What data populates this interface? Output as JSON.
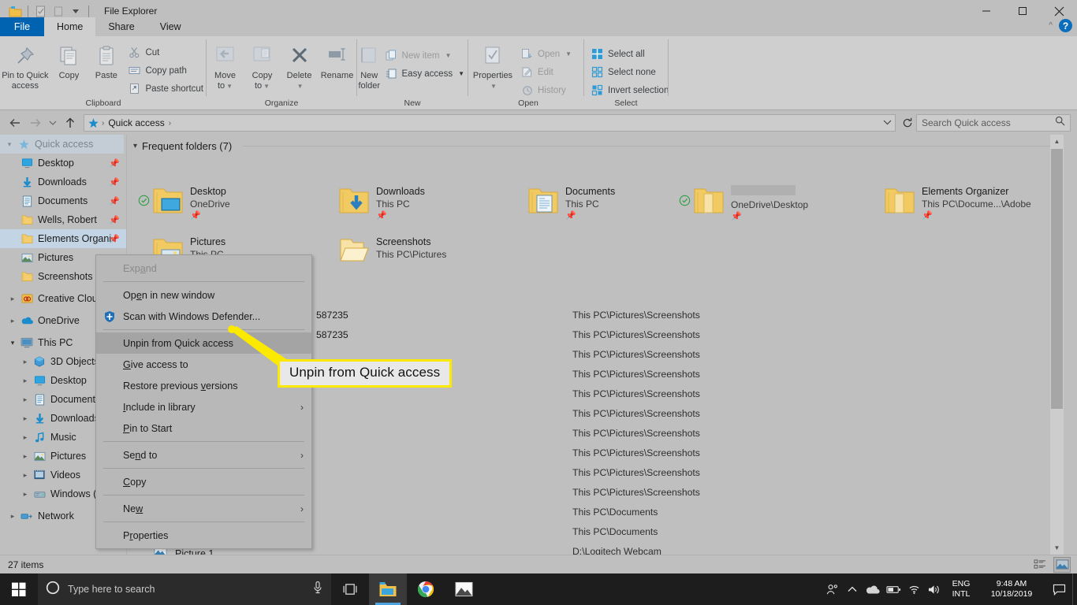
{
  "window": {
    "title": "File Explorer",
    "quick_access_toolbar": [
      "explorer-icon",
      "properties-icon",
      "new-folder-icon",
      "customize-dropdown"
    ],
    "controls": {
      "minimize": "minimize-icon",
      "maximize": "maximize-icon",
      "close": "close-icon"
    }
  },
  "ribbon": {
    "tabs": [
      {
        "label": "File",
        "active": false,
        "file": true
      },
      {
        "label": "Home",
        "active": true
      },
      {
        "label": "Share",
        "active": false
      },
      {
        "label": "View",
        "active": false
      }
    ],
    "help_label": "?",
    "groups": [
      {
        "title": "Clipboard",
        "big_buttons": [
          {
            "label": "Pin to Quick\naccess",
            "line1": "Pin to Quick",
            "line2": "access",
            "icon": "pin-icon"
          },
          {
            "label": "Copy",
            "line1": "Copy",
            "line2": "",
            "icon": "copy-icon"
          },
          {
            "label": "Paste",
            "line1": "Paste",
            "line2": "",
            "icon": "paste-icon"
          }
        ],
        "small_buttons": [
          {
            "label": "Cut",
            "icon": "scissors-icon"
          },
          {
            "label": "Copy path",
            "icon": "copy-path-icon"
          },
          {
            "label": "Paste shortcut",
            "icon": "paste-shortcut-icon"
          }
        ]
      },
      {
        "title": "Organize",
        "big_buttons": [
          {
            "line1": "Move",
            "line2": "to",
            "icon": "move-to-icon",
            "dropdown": true,
            "disabled": true
          },
          {
            "line1": "Copy",
            "line2": "to",
            "icon": "copy-to-icon",
            "dropdown": true,
            "disabled": true
          },
          {
            "line1": "Delete",
            "line2": "",
            "icon": "delete-icon",
            "dropdown": true
          },
          {
            "line1": "Rename",
            "line2": "",
            "icon": "rename-icon"
          }
        ]
      },
      {
        "title": "New",
        "big_buttons": [
          {
            "line1": "New",
            "line2": "folder",
            "icon": "new-folder-icon"
          }
        ],
        "small_buttons": [
          {
            "label": "New item",
            "icon": "new-item-icon",
            "dropdown": true
          },
          {
            "label": "Easy access",
            "icon": "easy-access-icon",
            "dropdown": true
          }
        ]
      },
      {
        "title": "Open",
        "big_buttons": [
          {
            "line1": "Properties",
            "line2": "",
            "icon": "properties-icon",
            "dropdown": true
          }
        ],
        "small_buttons": [
          {
            "label": "Open",
            "icon": "open-icon",
            "dropdown": true
          },
          {
            "label": "Edit",
            "icon": "edit-icon"
          },
          {
            "label": "History",
            "icon": "history-icon"
          }
        ]
      },
      {
        "title": "Select",
        "small_buttons": [
          {
            "label": "Select all",
            "icon": "select-all-icon"
          },
          {
            "label": "Select none",
            "icon": "select-none-icon"
          },
          {
            "label": "Invert selection",
            "icon": "invert-selection-icon"
          }
        ]
      }
    ]
  },
  "addressbar": {
    "back": "back-arrow-icon",
    "forward": "forward-arrow-icon",
    "recent": "recent-locations-icon",
    "up": "up-arrow-icon",
    "crumb_icon": "quick-access-star-icon",
    "crumbs": [
      "Quick access"
    ],
    "refresh": "refresh-icon",
    "dropdown": "chevron-down-icon"
  },
  "search": {
    "placeholder": "Search Quick access",
    "icon": "search-icon"
  },
  "navpane": {
    "items": [
      {
        "label": "Quick access",
        "icon": "star-icon",
        "indent": 0,
        "chevron": "open",
        "selected": false
      },
      {
        "label": "Desktop",
        "icon": "desktop-icon",
        "indent": 1,
        "chevron": "none",
        "pinned": true
      },
      {
        "label": "Downloads",
        "icon": "downloads-icon",
        "indent": 1,
        "chevron": "none",
        "pinned": true
      },
      {
        "label": "Documents",
        "icon": "documents-icon",
        "indent": 1,
        "chevron": "none",
        "pinned": true
      },
      {
        "label": "Wells, Robert",
        "icon": "folder-icon",
        "indent": 1,
        "chevron": "none",
        "pinned": true
      },
      {
        "label": "Elements Organi",
        "icon": "folder-icon",
        "indent": 1,
        "chevron": "none",
        "pinned": true,
        "selected": true
      },
      {
        "label": "Pictures",
        "icon": "pictures-icon",
        "indent": 1,
        "chevron": "none",
        "pinned": false
      },
      {
        "label": "Screenshots",
        "icon": "folder-icon",
        "indent": 1,
        "chevron": "none",
        "pinned": false
      },
      {
        "label": "Creative Cloud",
        "icon": "creative-cloud-icon",
        "indent": 0,
        "chevron": "closed"
      },
      {
        "label": "OneDrive",
        "icon": "onedrive-icon",
        "indent": 0,
        "chevron": "closed"
      },
      {
        "label": "This PC",
        "icon": "this-pc-icon",
        "indent": 0,
        "chevron": "open"
      },
      {
        "label": "3D Objects",
        "icon": "3d-objects-icon",
        "indent": 1,
        "chevron": "closed"
      },
      {
        "label": "Desktop",
        "icon": "desktop-icon",
        "indent": 1,
        "chevron": "closed"
      },
      {
        "label": "Documents",
        "icon": "documents-icon",
        "indent": 1,
        "chevron": "closed"
      },
      {
        "label": "Downloads",
        "icon": "downloads-icon",
        "indent": 1,
        "chevron": "closed"
      },
      {
        "label": "Music",
        "icon": "music-icon",
        "indent": 1,
        "chevron": "closed"
      },
      {
        "label": "Pictures",
        "icon": "pictures-icon",
        "indent": 1,
        "chevron": "closed"
      },
      {
        "label": "Videos",
        "icon": "videos-icon",
        "indent": 1,
        "chevron": "closed"
      },
      {
        "label": "Windows (C:)",
        "icon": "drive-icon",
        "indent": 1,
        "chevron": "closed"
      },
      {
        "label": "Network",
        "icon": "network-icon",
        "indent": 0,
        "chevron": "closed"
      }
    ]
  },
  "main": {
    "section_header": "Frequent folders (7)",
    "frequent_folders": [
      {
        "name": "Desktop",
        "path": "OneDrive",
        "icon": "folder-desktop-icon",
        "pinned": true,
        "sync": true,
        "redacted": false
      },
      {
        "name": "Downloads",
        "path": "This PC",
        "icon": "folder-downloads-icon",
        "pinned": true,
        "sync": false,
        "redacted": false
      },
      {
        "name": "Documents",
        "path": "This PC",
        "icon": "folder-documents-icon",
        "pinned": true,
        "sync": false,
        "redacted": false
      },
      {
        "name": "",
        "path": "OneDrive\\Desktop",
        "icon": "folder-icon",
        "pinned": true,
        "sync": true,
        "redacted": true
      },
      {
        "name": "Elements Organizer",
        "path": "This PC\\Docume...\\Adobe",
        "icon": "folder-icon",
        "pinned": true,
        "sync": false,
        "redacted": false
      },
      {
        "name": "Pictures",
        "path": "This PC",
        "icon": "folder-pictures-icon",
        "pinned": true,
        "sync": false,
        "redacted": false
      },
      {
        "name": "Screenshots",
        "path": "This PC\\Pictures",
        "icon": "folder-open-icon",
        "pinned": false,
        "sync": false,
        "redacted": false
      }
    ],
    "detail_rows": [
      {
        "name": "587235",
        "path": "This PC\\Pictures\\Screenshots"
      },
      {
        "name": "587235",
        "path": "This PC\\Pictures\\Screenshots"
      },
      {
        "name": "",
        "path": "This PC\\Pictures\\Screenshots"
      },
      {
        "name": "",
        "path": "This PC\\Pictures\\Screenshots"
      },
      {
        "name": "",
        "path": "This PC\\Pictures\\Screenshots"
      },
      {
        "name": "",
        "path": "This PC\\Pictures\\Screenshots"
      },
      {
        "name": "",
        "path": "This PC\\Pictures\\Screenshots"
      },
      {
        "name": "",
        "path": "This PC\\Pictures\\Screenshots"
      },
      {
        "name": "",
        "path": "This PC\\Pictures\\Screenshots"
      },
      {
        "name": "",
        "path": "This PC\\Pictures\\Screenshots"
      },
      {
        "name": "",
        "path": "This PC\\Documents"
      },
      {
        "name": "",
        "path": "This PC\\Documents"
      },
      {
        "name": "",
        "path": "D:\\Logitech Webcam"
      }
    ],
    "bottom_item": {
      "name": "Picture 1",
      "icon": "picture-file-icon"
    }
  },
  "context_menu": {
    "items": [
      {
        "label": "Expand",
        "disabled": true,
        "icon": null,
        "submenu": false,
        "highlight": false
      },
      {
        "separator": true
      },
      {
        "label": "Open in new window",
        "disabled": false,
        "icon": null,
        "submenu": false,
        "highlight": false,
        "accel": "e"
      },
      {
        "label": "Scan with Windows Defender...",
        "disabled": false,
        "icon": "windows-defender-icon",
        "submenu": false,
        "highlight": false
      },
      {
        "separator": true
      },
      {
        "label": "Unpin from Quick access",
        "disabled": false,
        "icon": null,
        "submenu": false,
        "highlight": true
      },
      {
        "label": "Give access to",
        "disabled": false,
        "icon": null,
        "submenu": true,
        "highlight": false,
        "accel": "G"
      },
      {
        "label": "Restore previous versions",
        "disabled": false,
        "icon": null,
        "submenu": false,
        "highlight": false,
        "accel": "v"
      },
      {
        "label": "Include in library",
        "disabled": false,
        "icon": null,
        "submenu": true,
        "highlight": false,
        "accel": "I"
      },
      {
        "label": "Pin to Start",
        "disabled": false,
        "icon": null,
        "submenu": false,
        "highlight": false,
        "accel": "P"
      },
      {
        "separator": true
      },
      {
        "label": "Send to",
        "disabled": false,
        "icon": null,
        "submenu": true,
        "highlight": false,
        "accel": "n"
      },
      {
        "separator": true
      },
      {
        "label": "Copy",
        "disabled": false,
        "icon": null,
        "submenu": false,
        "highlight": false,
        "accel": "C"
      },
      {
        "separator": true
      },
      {
        "label": "New",
        "disabled": false,
        "icon": null,
        "submenu": true,
        "highlight": false,
        "accel": "w"
      },
      {
        "separator": true
      },
      {
        "label": "Properties",
        "disabled": false,
        "icon": null,
        "submenu": false,
        "highlight": false,
        "accel": "r"
      }
    ]
  },
  "callout": {
    "text": "Unpin from Quick access",
    "border_color": "#fbe900",
    "background": "#e8e8e8"
  },
  "statusbar": {
    "item_count": "27 items",
    "view_buttons": [
      {
        "name": "details-view-button",
        "active": false
      },
      {
        "name": "large-icons-view-button",
        "active": true
      }
    ]
  },
  "taskbar": {
    "start_icon": "windows-start-icon",
    "search_placeholder": "Type here to search",
    "cortana_icon": "cortana-circle-icon",
    "mic_icon": "microphone-icon",
    "taskview_icon": "task-view-icon",
    "apps": [
      {
        "name": "file-explorer-taskbar-icon",
        "active": true
      },
      {
        "name": "chrome-taskbar-icon",
        "active": false
      },
      {
        "name": "photos-taskbar-icon",
        "active": false
      }
    ],
    "tray": {
      "icons": [
        "people-icon",
        "show-hidden-icons-chevron",
        "onedrive-cloud-icon",
        "battery-icon",
        "wifi-icon",
        "volume-icon"
      ],
      "language_line1": "ENG",
      "language_line2": "INTL",
      "time": "9:48 AM",
      "date": "10/18/2019",
      "action_center": "action-center-icon"
    }
  }
}
